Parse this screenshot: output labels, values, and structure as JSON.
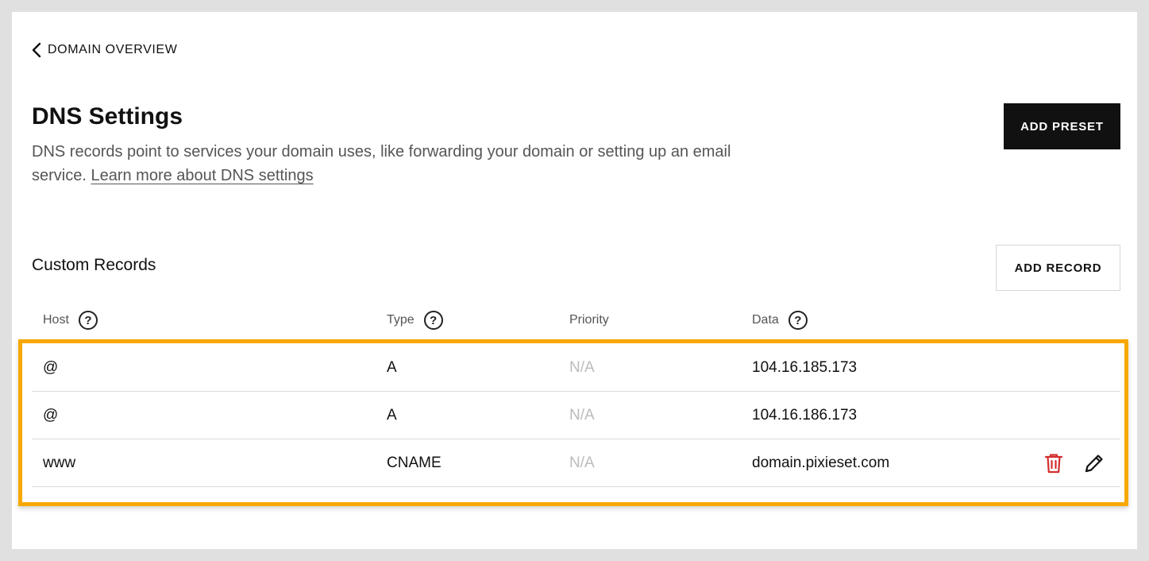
{
  "nav": {
    "back_label": "DOMAIN OVERVIEW",
    "back_icon": "chevron-left-icon"
  },
  "header": {
    "title": "DNS Settings",
    "description": "DNS records point to services your domain uses, like forwarding your domain or setting up an email service.",
    "learn_more_label": "Learn more about DNS settings",
    "add_preset_label": "ADD PRESET"
  },
  "records": {
    "section_title": "Custom Records",
    "add_record_label": "ADD RECORD",
    "columns": [
      {
        "label": "Host",
        "help": true
      },
      {
        "label": "Type",
        "help": true
      },
      {
        "label": "Priority",
        "help": false
      },
      {
        "label": "Data",
        "help": true
      }
    ],
    "help_glyph": "?",
    "rows": [
      {
        "host": "@",
        "type": "A",
        "priority": "N/A",
        "data": "104.16.185.173",
        "actions": false
      },
      {
        "host": "@",
        "type": "A",
        "priority": "N/A",
        "data": "104.16.186.173",
        "actions": false
      },
      {
        "host": "www",
        "type": "CNAME",
        "priority": "N/A",
        "data": "domain.pixieset.com",
        "actions": true
      }
    ]
  },
  "colors": {
    "highlight": "#f7a800",
    "delete_icon": "#d32f2f",
    "primary_button": "#111111",
    "muted_text": "#bbbbbb"
  }
}
